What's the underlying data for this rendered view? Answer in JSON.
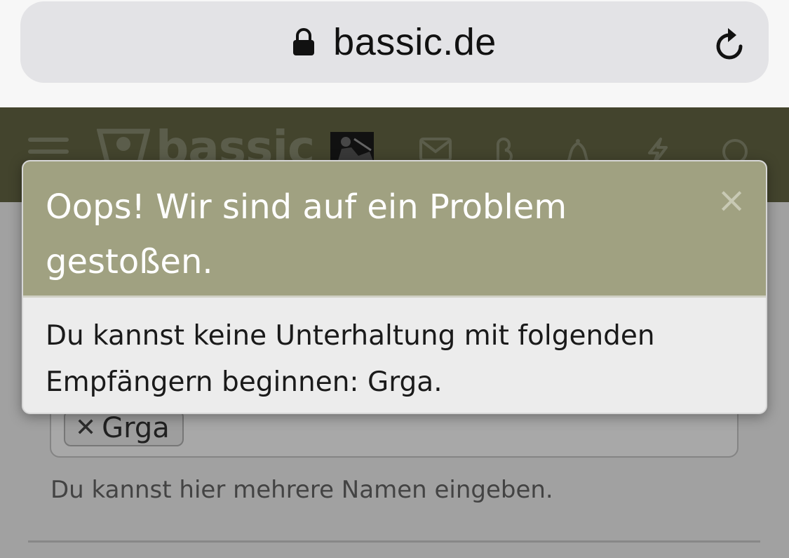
{
  "browser": {
    "url": "bassic.de",
    "lock_icon": "lock-icon",
    "reload_icon": "reload-icon"
  },
  "header": {
    "logo_text": "bassic",
    "icons": [
      "menu-icon",
      "shield-logo-icon",
      "avatar",
      "mail-icon",
      "bassic-b-icon",
      "bell-icon",
      "lightning-icon",
      "search-icon"
    ],
    "background": "#666845"
  },
  "form": {
    "recipient_token": "Grga",
    "hint": "Du kannst hier mehrere Namen eingeben."
  },
  "modal": {
    "title": "Oops! Wir sind auf ein Problem gestoßen.",
    "close_label": "×",
    "message": "Du kannst keine Unterhaltung mit folgenden Empfängern beginnen: Grga.",
    "header_color": "#a0a181"
  }
}
